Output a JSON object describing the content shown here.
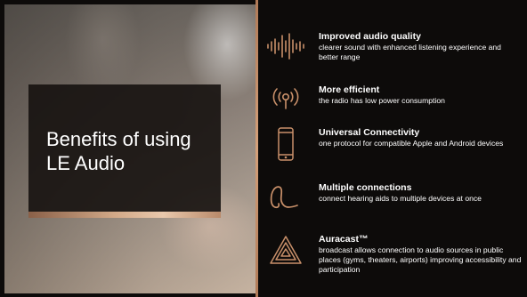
{
  "slide": {
    "title": "Benefits of using LE Audio",
    "benefits": [
      {
        "icon": "audio-waveform-icon",
        "heading": "Improved audio quality",
        "description": "clearer sound with enhanced listening experience and better range"
      },
      {
        "icon": "wireless-signal-icon",
        "heading": "More efficient",
        "description": "the radio has low power consumption"
      },
      {
        "icon": "smartphone-icon",
        "heading": "Universal Connectivity",
        "description": "one protocol for compatible Apple and Android devices"
      },
      {
        "icon": "hearing-aid-icon",
        "heading": "Multiple connections",
        "description": "connect hearing aids to multiple devices at once"
      },
      {
        "icon": "auracast-icon",
        "heading": "Auracast™",
        "description": "broadcast allows connection to audio sources in public places (gyms, theaters, airports) improving accessibility and participation"
      }
    ]
  },
  "colors": {
    "background": "#0d0b0a",
    "accent_copper": "#c9906a",
    "text": "#ffffff"
  }
}
